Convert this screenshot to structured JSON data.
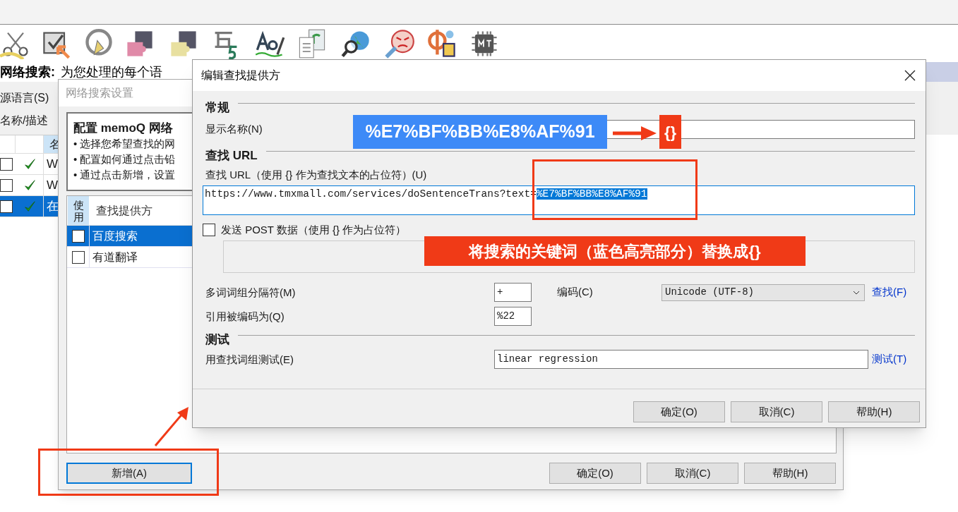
{
  "background_window": {
    "heading": "网络搜索:",
    "heading_rest": "为您处理的每个语",
    "source_language_label": "源语言(S)",
    "name_filter_label": "名称/描述",
    "table": {
      "column_header": "名",
      "rows": [
        {
          "checked": false,
          "enabled": true,
          "text": "W",
          "selected": false
        },
        {
          "checked": false,
          "enabled": true,
          "text": "W",
          "selected": false
        },
        {
          "checked": false,
          "enabled": true,
          "text": "在",
          "selected": true
        }
      ]
    }
  },
  "settings_dialog": {
    "title": "网络搜索设置",
    "info": {
      "title": "配置 memoQ 网络",
      "bullets": [
        "• 选择您希望查找的网",
        "• 配置如何通过点击铅",
        "• 通过点击新增，设置"
      ]
    },
    "providers": {
      "columns": [
        "使用",
        "查找提供方"
      ],
      "rows": [
        {
          "name": "百度搜索",
          "checked": false,
          "selected": true
        },
        {
          "name": "有道翻译",
          "checked": false,
          "selected": false
        }
      ]
    },
    "add_button": {
      "label": "新增(A)",
      "focused": true
    },
    "buttons": [
      "确定(O)",
      "取消(C)",
      "帮助(H)"
    ]
  },
  "edit_dialog": {
    "title": "编辑查找提供方",
    "general_heading": "常规",
    "display_name_label": "显示名称(N)",
    "url_heading": "查找 URL",
    "url_label": "查找 URL（使用 {} 作为查找文本的占位符）(U)",
    "url_field": {
      "value": "https://www.tmxmall.com/services/doSentenceTrans?text=",
      "selection": "%E7%BF%BB%E8%AF%91"
    },
    "post": {
      "label": "发送 POST 数据（使用 {} 作为占位符）",
      "checked": false
    },
    "separator_label": "多词词组分隔符(M)",
    "separator_value": "+",
    "encoding_label": "编码(C)",
    "encoding_value": "Unicode (UTF-8)",
    "lookup_link": "查找(F)",
    "quote_label": "引用被编码为(Q)",
    "quote_value": "%22",
    "test_heading": "测试",
    "test_label": "用查找词组测试(E)",
    "test_value": "linear regression",
    "test_link": "测试(T)",
    "buttons": [
      "确定(O)",
      "取消(C)",
      "帮助(H)"
    ]
  },
  "annotations": {
    "encoded_label": "%E7%BF%BB%E8%AF%91",
    "placeholder_label": "{}",
    "callout": "将搜索的关键词（蓝色高亮部分）替换成{}"
  }
}
